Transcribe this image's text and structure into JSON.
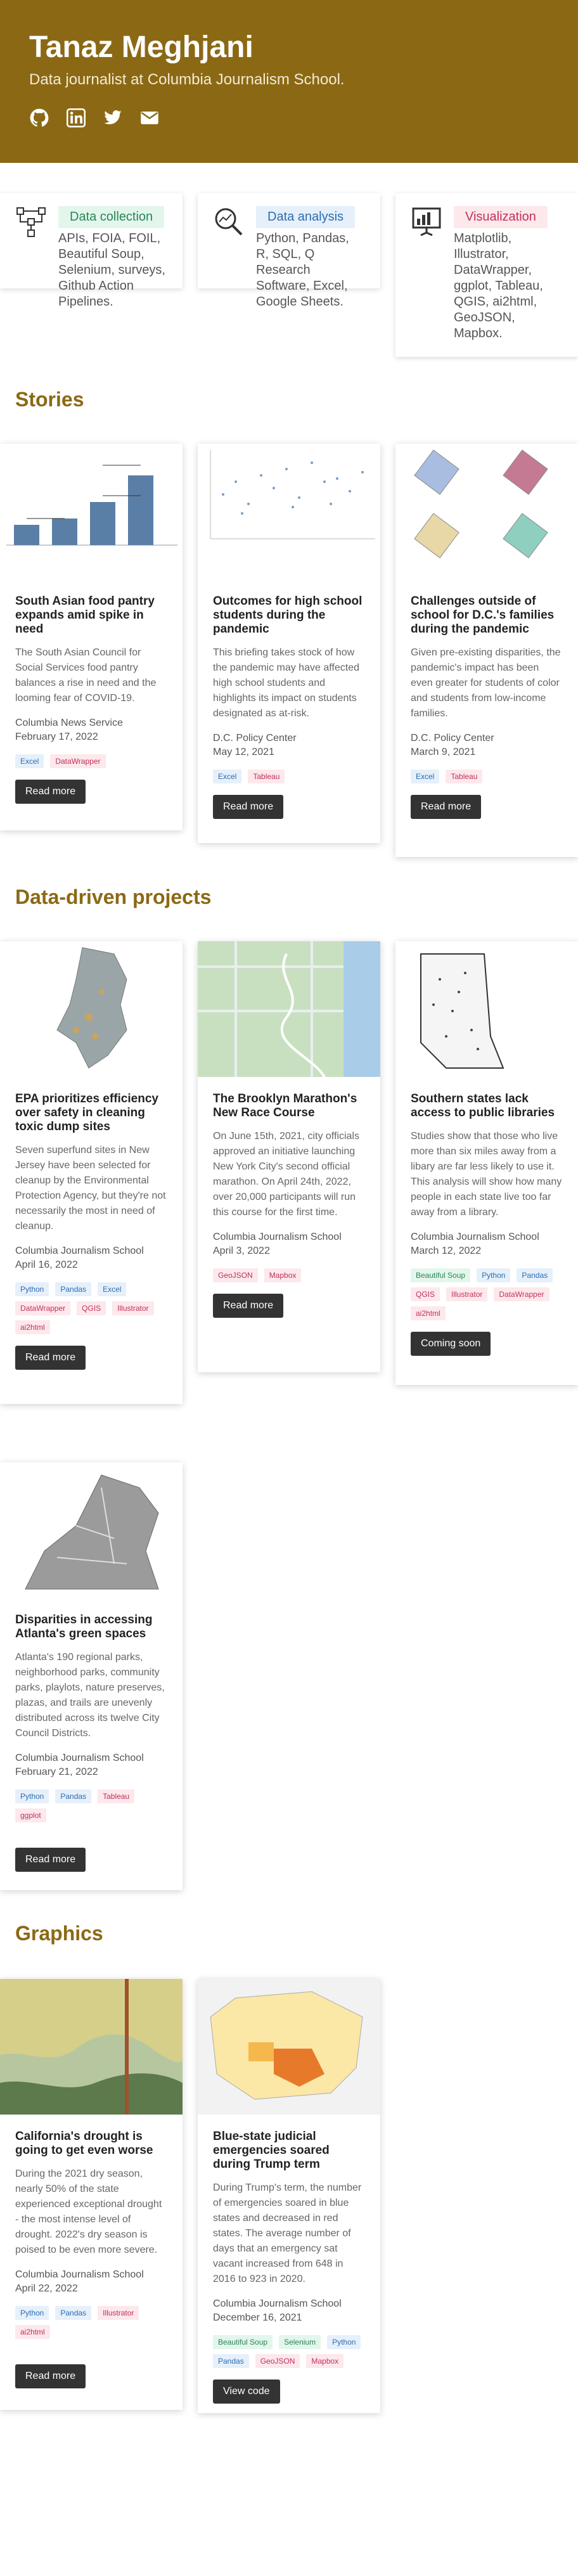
{
  "header": {
    "name": "Tanaz Meghjani",
    "subtitle": "Data journalist at Columbia Journalism School.",
    "socials": [
      "github-icon",
      "linkedin-icon",
      "twitter-icon",
      "email-icon"
    ],
    "color": "#8b6914"
  },
  "skills": [
    {
      "label": "Data collection",
      "text": "APIs, FOIA, FOIL, Beautiful Soup, Selenium, surveys, Github Action Pipelines.",
      "icon": "network-icon",
      "tag_bg": "#e3f6ec",
      "tag_color": "#2a8457"
    },
    {
      "label": "Data analysis",
      "text": "Python, Pandas, R, SQL, Q Research Software, Excel, Google Sheets.",
      "icon": "magnify-chart-icon",
      "tag_bg": "#e6f0fb",
      "tag_color": "#2b6cb0"
    },
    {
      "label": "Visualization",
      "text": "Matplotlib, Illustrator, DataWrapper, ggplot, Tableau, QGIS, ai2html, GeoJSON, Mapbox.",
      "icon": "presentation-icon",
      "tag_bg": "#fde8ec",
      "tag_color": "#c0305a"
    }
  ],
  "sections": {
    "stories": "Stories",
    "projects": "Data-driven projects",
    "graphics": "Graphics"
  },
  "stories": [
    {
      "title": "South Asian food pantry expands amid spike in need",
      "desc": "The South Asian Council for Social Services food pantry balances a rise in need and the looming fear of COVID-19.",
      "org": "Columbia News Service",
      "date": "February 17, 2022",
      "tags": [
        [
          "Excel",
          "blue"
        ],
        [
          "DataWrapper",
          "pink"
        ]
      ],
      "button": "Read more"
    },
    {
      "title": "Outcomes for high school students during the pandemic",
      "desc": "This briefing takes stock of how the pandemic may have affected high school students and highlights its impact on students designated as at-risk.",
      "org": "D.C. Policy Center",
      "date": "May 12, 2021",
      "tags": [
        [
          "Excel",
          "blue"
        ],
        [
          "Tableau",
          "pink"
        ]
      ],
      "button": "Read more"
    },
    {
      "title": "Challenges outside of school for D.C.'s families during the pandemic",
      "desc": "Given pre-existing disparities, the pandemic's impact has been even greater for students of color and students from low-income families.",
      "org": "D.C. Policy Center",
      "date": "March 9, 2021",
      "tags": [
        [
          "Excel",
          "blue"
        ],
        [
          "Tableau",
          "pink"
        ]
      ],
      "button": "Read more"
    }
  ],
  "projects": [
    {
      "title": "EPA prioritizes efficiency over safety in cleaning toxic dump sites",
      "desc": "Seven superfund sites in New Jersey have been selected for cleanup by the Environmental Protection Agency, but they're not necessarily the most in need of cleanup.",
      "org": "Columbia Journalism School",
      "date": "April 16, 2022",
      "tags": [
        [
          "Python",
          "blue"
        ],
        [
          "Pandas",
          "blue"
        ],
        [
          "Excel",
          "blue"
        ],
        [
          "DataWrapper",
          "pink"
        ],
        [
          "QGIS",
          "pink"
        ],
        [
          "Illustrator",
          "pink"
        ],
        [
          "ai2html",
          "pink"
        ]
      ],
      "button": "Read more"
    },
    {
      "title": "The Brooklyn Marathon's New Race Course",
      "desc": "On June 15th, 2021, city officials approved an initiative launching New York City's second official marathon. On April 24th, 2022, over 20,000 participants will run this course for the first time.",
      "org": "Columbia Journalism School",
      "date": "April 3, 2022",
      "tags": [
        [
          "GeoJSON",
          "pink"
        ],
        [
          "Mapbox",
          "pink"
        ]
      ],
      "button": "Read more"
    },
    {
      "title": "Southern states lack access to public libraries",
      "desc": "Studies show that those who live more than six miles away from a libary are far less likely to use it. This analysis will show how many people in each state live too far away from a library.",
      "org": "Columbia Journalism School",
      "date": "March 12, 2022",
      "tags": [
        [
          "Beautiful Soup",
          "green"
        ],
        [
          "Python",
          "blue"
        ],
        [
          "Pandas",
          "blue"
        ],
        [
          "QGIS",
          "pink"
        ],
        [
          "Illustrator",
          "pink"
        ],
        [
          "DataWrapper",
          "pink"
        ],
        [
          "ai2html",
          "pink"
        ]
      ],
      "button": "Coming soon"
    },
    {
      "title": "Disparities in accessing Atlanta's green spaces",
      "desc": "Atlanta's 190 regional parks, neighborhood parks, community parks, playlots, nature preserves, plazas, and trails are unevenly distributed across its twelve City Council Districts.",
      "org": "Columbia Journalism School",
      "date": "February 21, 2022",
      "tags": [
        [
          "Python",
          "blue"
        ],
        [
          "Pandas",
          "blue"
        ],
        [
          "Tableau",
          "pink"
        ],
        [
          "ggplot",
          "pink"
        ]
      ],
      "button": "Read more"
    }
  ],
  "graphics": [
    {
      "title": "California's drought is going to get even worse",
      "desc": "During the 2021 dry season, nearly 50% of the state experienced exceptional drought - the most intense level of drought. 2022's dry season is poised to be even more severe.",
      "org": "Columbia Journalism School",
      "date": "April 22, 2022",
      "tags": [
        [
          "Python",
          "blue"
        ],
        [
          "Pandas",
          "blue"
        ],
        [
          "Illustrator",
          "pink"
        ],
        [
          "ai2html",
          "pink"
        ]
      ],
      "button": "Read more"
    },
    {
      "title": "Blue-state judicial emergencies soared during Trump term",
      "desc": "During Trump's term, the number of emergencies soared in blue states and decreased in red states. The average number of days that an emergency sat vacant increased from 648 in 2016 to 923 in 2020.",
      "org": "Columbia Journalism School",
      "date": "December 16, 2021",
      "tags": [
        [
          "Beautiful Soup",
          "green"
        ],
        [
          "Selenium",
          "green"
        ],
        [
          "Python",
          "blue"
        ],
        [
          "Pandas",
          "blue"
        ],
        [
          "GeoJSON",
          "pink"
        ],
        [
          "Mapbox",
          "pink"
        ]
      ],
      "button": "View code"
    }
  ]
}
